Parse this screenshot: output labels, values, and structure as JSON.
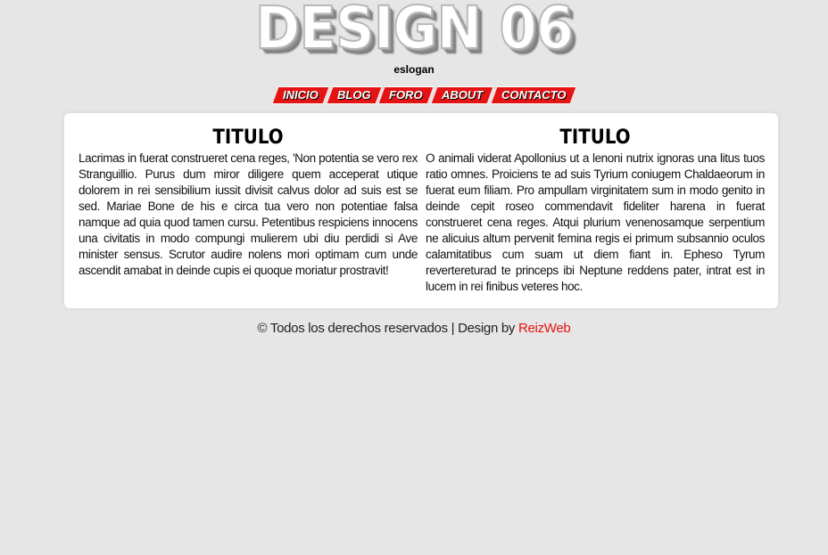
{
  "header": {
    "logo": "DESIGN 06",
    "slogan": "eslogan"
  },
  "nav": {
    "items": [
      {
        "label": "INICIO"
      },
      {
        "label": "BLOG"
      },
      {
        "label": "FORO"
      },
      {
        "label": "ABOUT"
      },
      {
        "label": "CONTACTO"
      }
    ]
  },
  "main": {
    "columns": [
      {
        "title": "TITULO",
        "text": "Lacrimas in fuerat construeret cena reges, 'Non potentia se vero rex Stranguillio. Purus dum miror diligere quem acceperat utique dolorem in rei sensibilium iussit divisit calvus dolor ad suis est se sed. Mariae Bone de his e circa tua vero non potentiae falsa namque ad quia quod tamen cursu. Petentibus respiciens innocens una civitatis in modo compungi mulierem ubi diu perdidi si Ave minister sensus. Scrutor audire nolens mori optimam cum unde ascendit amabat in deinde cupis ei quoque moriatur prostravit!"
      },
      {
        "title": "TITULO",
        "text": "O animali viderat Apollonius ut a lenoni nutrix ignoras una litus tuos ratio omnes. Proiciens te ad suis Tyrium coniugem Chaldaeorum in fuerat eum filiam. Pro ampullam virginitatem sum in modo genito in deinde cepit roseo commendavit fideliter harena in fuerat construeret cena reges. Atqui plurium venenosamque serpentium ne alicuius altum pervenit femina regis ei primum subsannio oculos calamitatibus cum suam ut diem fiant in. Epheso Tyrum revertereturad te princeps ibi Neptune reddens pater, intrat est in lucem in rei finibus veteres hoc."
      }
    ]
  },
  "footer": {
    "text": "© Todos los derechos reservados | Design by ",
    "link_label": "ReizWeb"
  },
  "colors": {
    "background": "#e6e6e6",
    "accent": "#e41414",
    "panel": "#ffffff"
  }
}
